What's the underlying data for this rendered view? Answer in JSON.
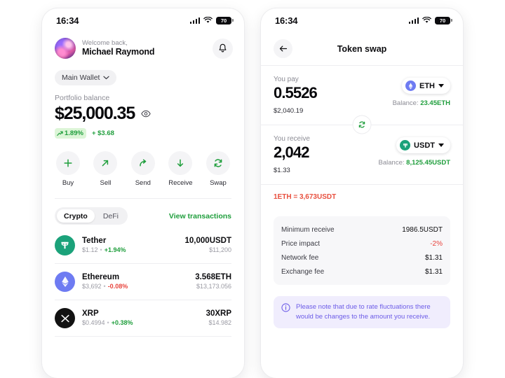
{
  "status_bar": {
    "time": "16:34",
    "battery": "70"
  },
  "wallet": {
    "welcome_label": "Welcome back,",
    "user_name": "Michael Raymond",
    "notification_icon": "bell-icon",
    "wallet_selector": "Main Wallet",
    "balance_label": "Portfolio balance",
    "balance_amount": "$25,000.35",
    "change_percent": "1.89%",
    "change_absolute": "+ $3.68",
    "actions": [
      {
        "label": "Buy",
        "icon": "plus-icon"
      },
      {
        "label": "Sell",
        "icon": "arrow-up-right-icon"
      },
      {
        "label": "Send",
        "icon": "share-arrow-icon"
      },
      {
        "label": "Receive",
        "icon": "arrow-down-icon"
      },
      {
        "label": "Swap",
        "icon": "swap-icon"
      }
    ],
    "segments": [
      {
        "label": "Crypto",
        "active": true
      },
      {
        "label": "DeFi",
        "active": false
      }
    ],
    "view_transactions": "View transactions",
    "tokens": [
      {
        "name": "Tether",
        "price": "$1.12",
        "change": "+1.94%",
        "change_dir": "pos",
        "quantity": "10,000USDT",
        "usd_value": "$11,200",
        "symbol": "T",
        "color": "#1ba27a"
      },
      {
        "name": "Ethereum",
        "price": "$3,692",
        "change": "-0.08%",
        "change_dir": "neg",
        "quantity": "3.568ETH",
        "usd_value": "$13,173.056",
        "symbol": "ETH",
        "color": "#6e7bf2"
      },
      {
        "name": "XRP",
        "price": "$0.4994",
        "change": "+0.38%",
        "change_dir": "pos",
        "quantity": "30XRP",
        "usd_value": "$14.982",
        "symbol": "X",
        "color": "#121212"
      }
    ]
  },
  "swap": {
    "back_icon": "back-arrow-icon",
    "title": "Token swap",
    "pay": {
      "caption": "You pay",
      "amount": "0.5526",
      "fiat": "$2,040.19",
      "token": "ETH",
      "token_color": "#6e7bf2",
      "balance_label": "Balance:",
      "balance_value": "23.45ETH"
    },
    "receive": {
      "caption": "You receive",
      "amount": "2,042",
      "fiat": "$1.33",
      "token": "USDT",
      "token_color": "#1ba27a",
      "balance_label": "Balance:",
      "balance_value": "8,125.45USDT"
    },
    "switch_icon": "swap-vertical-icon",
    "rate": "1ETH = 3,673USDT",
    "fees": [
      {
        "key": "Minimum receive",
        "value": "1986.5USDT",
        "tone": "normal"
      },
      {
        "key": "Price impact",
        "value": "-2%",
        "tone": "negative"
      },
      {
        "key": "Network fee",
        "value": "$1.31",
        "tone": "normal"
      },
      {
        "key": "Exchange fee",
        "value": "$1.31",
        "tone": "normal"
      }
    ],
    "notice": "Please note that due to rate fluctuations there would be changes to the amount you receive.",
    "notice_icon": "info-icon"
  }
}
